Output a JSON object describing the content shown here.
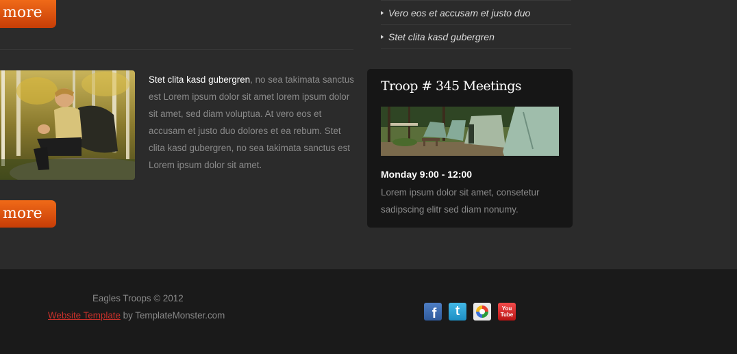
{
  "top_more_button": {
    "label": "more"
  },
  "bottom_more_button": {
    "label": "more"
  },
  "sidebar_list": {
    "items": [
      {
        "label": "Vero eos et accusam et justo duo"
      },
      {
        "label": "Stet clita kasd gubergren"
      }
    ]
  },
  "article": {
    "lead": "Stet clita kasd gubergren",
    "body": ", no sea takimata sanctus est Lorem ipsum dolor sit amet lorem ipsum dolor sit amet, sed diam voluptua. At vero eos et accusam et justo duo dolores et ea rebum. Stet clita kasd gubergren, no sea takimata sanctus est Lorem ipsum dolor sit amet."
  },
  "meetings": {
    "title": "Troop # 345 Meetings",
    "time": "Monday 9:00 - 12:00",
    "description": "Lorem ipsum dolor sit amet, consetetur sadipscing elitr sed diam nonumy."
  },
  "footer": {
    "copyright": "Eagles Troops © 2012",
    "link_label": "Website Template",
    "by_text": " by TemplateMonster.com"
  },
  "social": {
    "facebook_glyph": "f",
    "twitter_glyph": "t",
    "youtube_top": "You",
    "youtube_bottom": "Tube"
  },
  "colors": {
    "accent_orange": "#e05512",
    "link_red": "#c9312b",
    "background": "#2b2b2b",
    "footer_background": "#1a1a1a"
  }
}
